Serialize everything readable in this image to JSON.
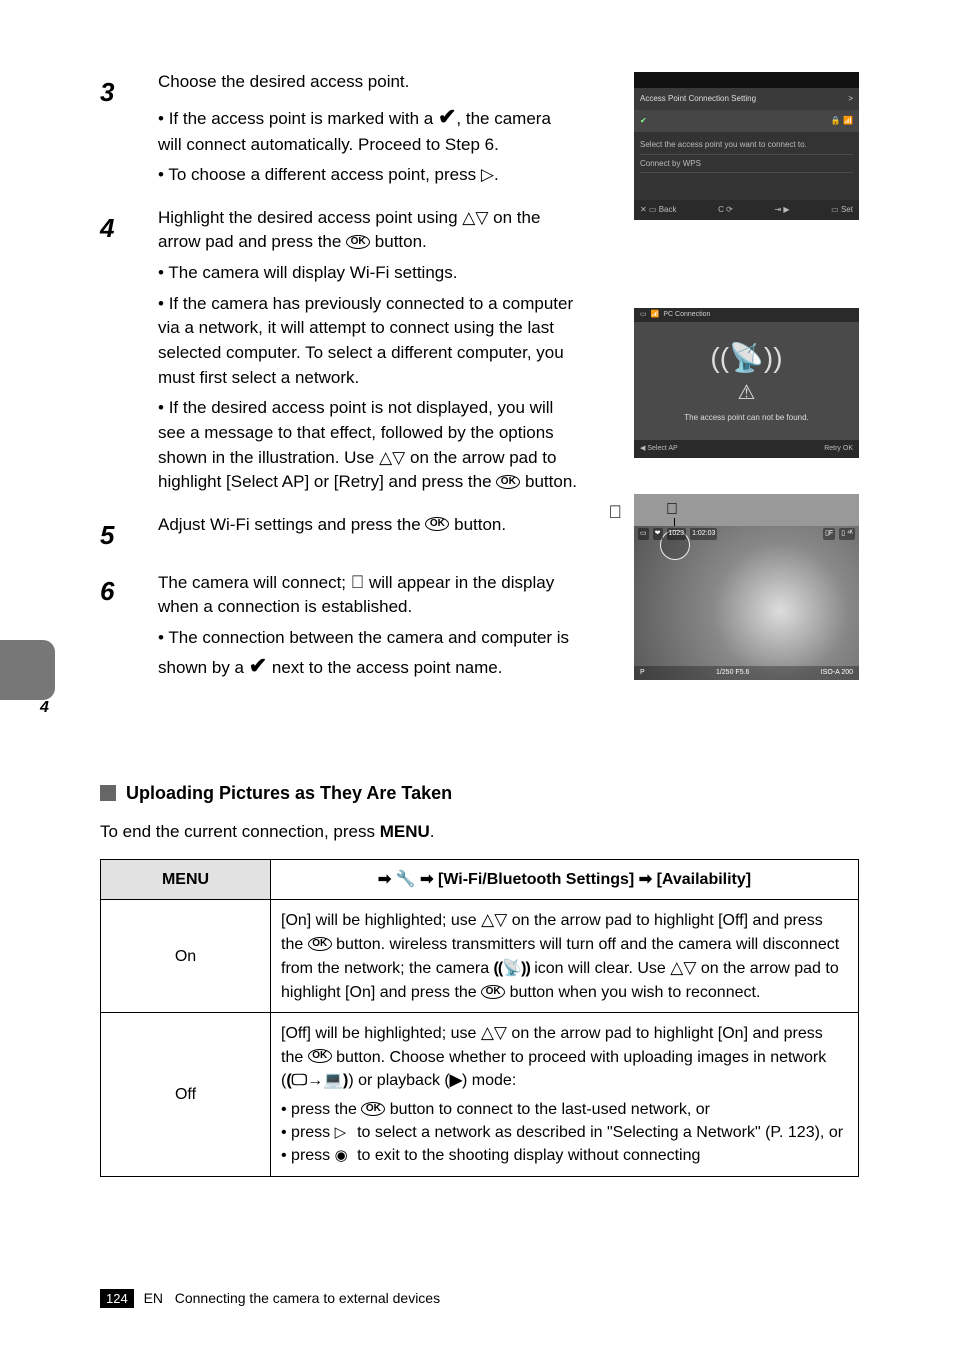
{
  "page": {
    "number": "124",
    "footer_en": "EN",
    "side_chapter": "4"
  },
  "thumb1": {
    "title": "Access Point Connection Setting",
    "row1": "Select the access point you want to connect to.",
    "row2_sub": "Connect by WPS",
    "foot_back": "Back",
    "foot_set": "Set"
  },
  "thumb2": {
    "hdr": "PC Connection",
    "msg": "The access point can not be found.",
    "foot_ap": "Select AP",
    "foot_retry": "Retry OK"
  },
  "thumb3": {
    "counter": "1023",
    "time": "1:02:03",
    "iso": "ISO-A 200",
    "f": "1/250  F5.6",
    "mode": "P"
  },
  "steps": {
    "s3": {
      "line1": "Choose the desired access point.",
      "bullet1_a": "If the access point is marked with a ",
      "bullet1_b": ", the camera will connect automatically. Proceed to Step 6.",
      "bullet2_a": "To choose a different access point, press ",
      "bullet2_b": "."
    },
    "s4": {
      "line1": "Highlight the desired access point using ",
      "line2_a": " on the arrow pad and press the ",
      "line2_b": " button.",
      "bullet1": "The camera will display Wi-Fi settings.",
      "bullet2_a": "If the camera has previously connected to a computer via a network, it will attempt to connect using the last selected computer. To select a different computer, you must first select a network.",
      "bullet3_a": "If the desired access point is not displayed, you will see a message to that effect, followed by the options shown in the illustration. Use ",
      "bullet3_b": " on the arrow pad to highlight [Select AP] or [Retry] and press the ",
      "bullet3_c": " button."
    },
    "s5": {
      "line1_a": "Adjust Wi-Fi settings and press the ",
      "line1_b": " button."
    },
    "s6": {
      "line1_a": "The camera will connect; ",
      "line1_b": " will appear in the display when a connection is established.",
      "bullet1_a": "The connection between the camera and computer is shown by a ",
      "bullet1_b": " next to the access point name."
    }
  },
  "section": {
    "title": "Uploading Pictures as They Are Taken",
    "sub_a": "To end the current connection, press ",
    "sub_b": "."
  },
  "table": {
    "hdr_left": "MENU",
    "hdr_right_b": "[Wi-Fi/Bluetooth Settings] ",
    "hdr_right_c": "[Availability]",
    "row1_label": "On",
    "row1_a": "[On] will be highlighted; use ",
    "row1_b": " on the arrow pad to highlight [Off] and press the ",
    "row1_c": " button. wireless transmitters will turn off and the camera will disconnect from the network; the camera ",
    "row1_d": " icon will clear. Use ",
    "row1_e": " on the arrow pad to highlight [On] and press the ",
    "row1_f": " button when you wish to reconnect.",
    "row2_label": "Off",
    "row2_a": "[Off] will be highlighted; use ",
    "row2_b": " on the arrow pad to highlight [On] and press the ",
    "row2_c": " button. Choose whether to proceed with uploading images in network (",
    "row2_d": ") or playback (",
    "row2_e": ") mode:",
    "row2_item1_a": "press the ",
    "row2_item1_b": " button to connect to the last-used network, or",
    "row2_item2_a": "press ",
    "row2_item2_b": " to select a network as described in \"Selecting a Network\" (P. 123), or",
    "row2_item3_a": "press ",
    "row2_item3_b": " to exit to the shooting display without connecting"
  },
  "footer": {
    "label": "Connecting the camera to external devices"
  }
}
